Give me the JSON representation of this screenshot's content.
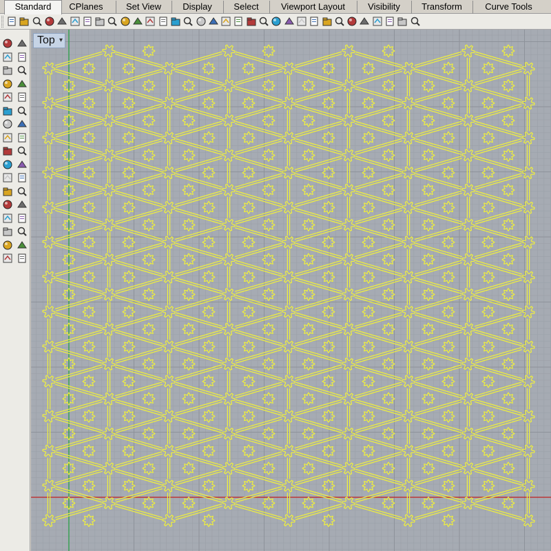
{
  "tabs": [
    {
      "label": "Standard",
      "active": true
    },
    {
      "label": "CPlanes"
    },
    {
      "label": "Set View"
    },
    {
      "label": "Display"
    },
    {
      "label": "Select"
    },
    {
      "label": "Viewport Layout"
    },
    {
      "label": "Visibility"
    },
    {
      "label": "Transform"
    },
    {
      "label": "Curve Tools"
    }
  ],
  "toolbar_icons": [
    "new-file-icon",
    "open-folder-icon",
    "save-icon",
    "print-icon",
    "import-icon",
    "copy-icon",
    "cut-icon",
    "paste-icon",
    "clipboard-icon",
    "undo-icon",
    "pan-hand-icon",
    "move-icon",
    "zoom-icon",
    "zoom-window-icon",
    "zoom-extents-icon",
    "zoom-selected-icon",
    "rotate-view-icon",
    "four-viewports-icon",
    "car-icon",
    "render-icon",
    "shade-icon",
    "select-point-icon",
    "osnap-icon",
    "lightbulb-icon",
    "layer-icon",
    "color-wheel-icon",
    "material-ball-icon",
    "render-sphere-icon",
    "rendered-sphere-icon",
    "brush-icon",
    "properties-icon",
    "network-icon",
    "help-icon"
  ],
  "left_icons": [
    "select-arrow-icon",
    "point-icon",
    "polyline-icon",
    "curve-icon",
    "circle-icon",
    "ellipse-icon",
    "arc-icon",
    "rectangle-icon",
    "polygon-icon",
    "fillet-curve-icon",
    "offset-icon",
    "extend-icon",
    "surface-icon",
    "sphere-icon",
    "box-icon",
    "solid-icon",
    "boolean-icon",
    "explode-icon",
    "join-icon",
    "trim-icon",
    "mesh-icon",
    "split-icon",
    "rebuild-icon",
    "project-icon",
    "text-icon",
    "dimension-icon",
    "block-icon",
    "group-icon",
    "array-icon",
    "lights-icon",
    "analyze-icon",
    "check-icon",
    "render-preview-icon",
    "paint-icon"
  ],
  "viewport": {
    "label": "Top",
    "caret": "▾",
    "background": "#a6abb3",
    "curve_color": "#f0f03c",
    "x_axis_color": "#c02020",
    "y_axis_color": "#1e9e3c"
  }
}
